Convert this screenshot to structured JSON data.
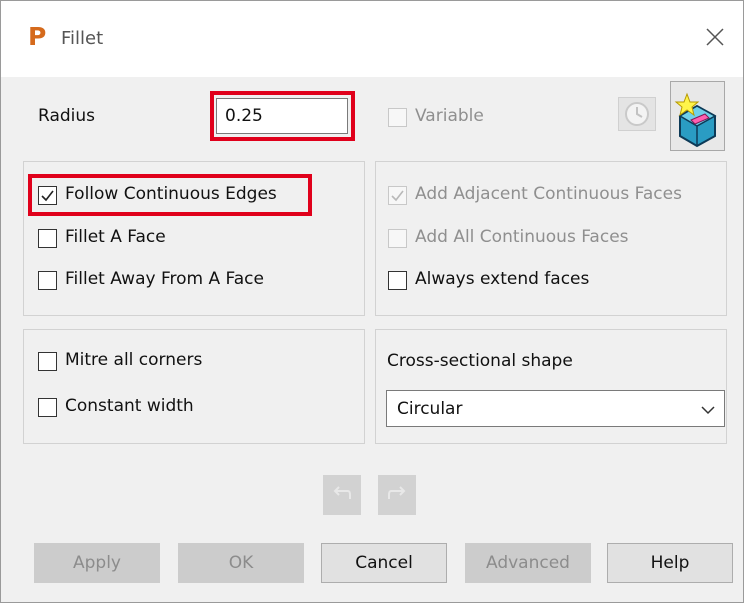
{
  "window": {
    "title": "Fillet"
  },
  "radius": {
    "label": "Radius",
    "value": "0.25"
  },
  "variable": {
    "label": "Variable",
    "checked": false,
    "enabled": false
  },
  "left_options": [
    {
      "label": "Follow Continuous Edges",
      "checked": true,
      "highlighted": true
    },
    {
      "label": "Fillet A Face",
      "checked": false
    },
    {
      "label": "Fillet Away From A Face",
      "checked": false
    }
  ],
  "right_options": [
    {
      "label": "Add Adjacent Continuous Faces",
      "checked": true,
      "enabled": false
    },
    {
      "label": "Add All Continuous Faces",
      "checked": false,
      "enabled": false
    },
    {
      "label": "Always extend faces",
      "checked": false,
      "enabled": true
    }
  ],
  "corner_options": [
    {
      "label": "Mitre all corners",
      "checked": false
    },
    {
      "label": "Constant width",
      "checked": false
    }
  ],
  "cross_section": {
    "label": "Cross-sectional shape",
    "value": "Circular"
  },
  "buttons": {
    "apply": "Apply",
    "ok": "OK",
    "cancel": "Cancel",
    "advanced": "Advanced",
    "help": "Help"
  },
  "colors": {
    "highlight": "#e0001b",
    "app_icon": "#d56a1c"
  }
}
